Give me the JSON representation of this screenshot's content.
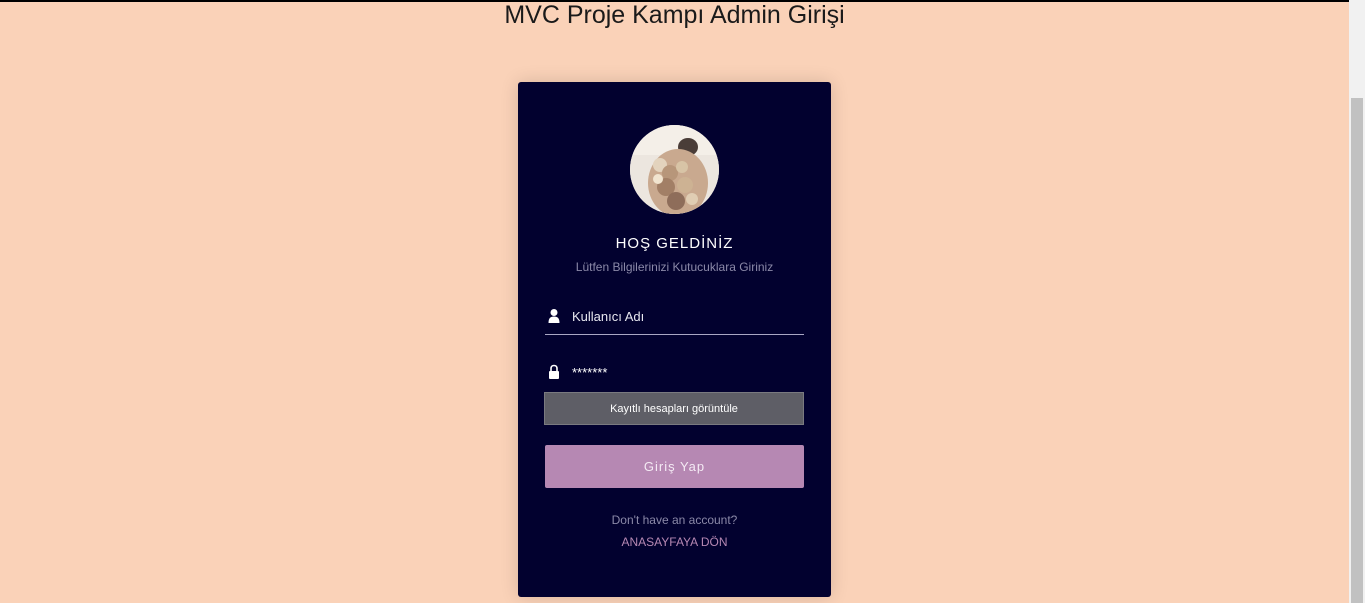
{
  "page": {
    "title": "MVC Proje Kampı Admin Girişi"
  },
  "login_card": {
    "avatar_icon": "avatar-photo",
    "welcome": "HOŞ GELDİNİZ",
    "subtitle": "Lütfen Bilgilerinizi Kutucuklara Giriniz",
    "username": {
      "icon": "user-icon",
      "placeholder": "Kullanıcı Adı",
      "value": ""
    },
    "password": {
      "icon": "lock-icon",
      "value": "*******"
    },
    "saved_accounts_label": "Kayıtlı hesapları görüntüle",
    "login_button": "Giriş Yap",
    "no_account_text": "Don't have an account?",
    "home_link": "ANASAYFAYA DÖN"
  },
  "colors": {
    "background": "#fad2b8",
    "card": "#02012f",
    "accent": "#b688b3",
    "saved_accounts_bg": "#5e5e66"
  }
}
